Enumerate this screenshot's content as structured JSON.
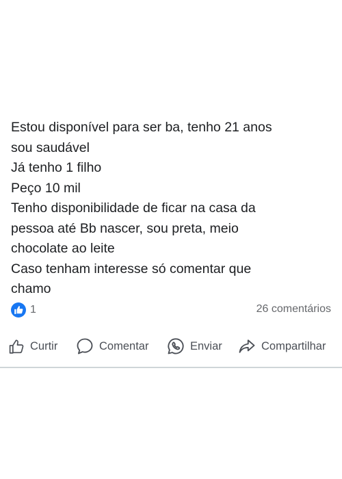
{
  "post": {
    "lines": [
      "Estou disponível para ser ba, tenho 21 anos",
      "sou saudável",
      "Já tenho 1 filho",
      "Peço 10 mil",
      "Tenho disponibilidade de ficar na casa da",
      "pessoa até Bb nascer, sou preta, meio",
      "chocolate ao leite",
      "Caso tenham interesse só comentar que",
      "chamo"
    ]
  },
  "stats": {
    "reaction_icon": "like-icon",
    "reaction_count": "1",
    "comments": "26 comentários"
  },
  "actions": {
    "like_label": "Curtir",
    "comment_label": "Comentar",
    "send_label": "Enviar",
    "share_label": "Compartilhar"
  },
  "colors": {
    "reaction_blue": "#1877f2",
    "text": "#1c1e21",
    "secondary_text": "#65676b",
    "action_text": "#4b4f56",
    "divider": "#cfd5d8"
  }
}
